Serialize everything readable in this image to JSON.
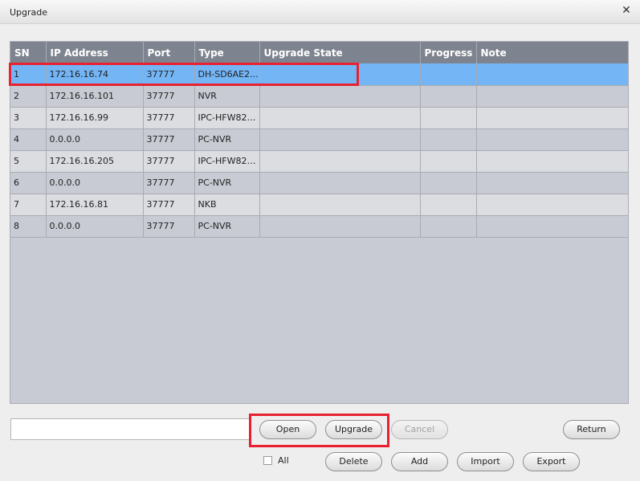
{
  "window": {
    "title": "Upgrade",
    "close_glyph": "✕"
  },
  "table": {
    "columns": [
      "SN",
      "IP Address",
      "Port",
      "Type",
      "Upgrade State",
      "Progress",
      "Note"
    ],
    "rows": [
      {
        "sn": "1",
        "ip": "172.16.16.74",
        "port": "37777",
        "type": "DH-SD6AE2...",
        "state": "",
        "progress": "",
        "note": ""
      },
      {
        "sn": "2",
        "ip": "172.16.16.101",
        "port": "37777",
        "type": "NVR",
        "state": "",
        "progress": "",
        "note": ""
      },
      {
        "sn": "3",
        "ip": "172.16.16.99",
        "port": "37777",
        "type": "IPC-HFW828...",
        "state": "",
        "progress": "",
        "note": ""
      },
      {
        "sn": "4",
        "ip": "0.0.0.0",
        "port": "37777",
        "type": "PC-NVR",
        "state": "",
        "progress": "",
        "note": ""
      },
      {
        "sn": "5",
        "ip": "172.16.16.205",
        "port": "37777",
        "type": "IPC-HFW828...",
        "state": "",
        "progress": "",
        "note": ""
      },
      {
        "sn": "6",
        "ip": "0.0.0.0",
        "port": "37777",
        "type": "PC-NVR",
        "state": "",
        "progress": "",
        "note": ""
      },
      {
        "sn": "7",
        "ip": "172.16.16.81",
        "port": "37777",
        "type": "NKB",
        "state": "",
        "progress": "",
        "note": ""
      },
      {
        "sn": "8",
        "ip": "0.0.0.0",
        "port": "37777",
        "type": "PC-NVR",
        "state": "",
        "progress": "",
        "note": ""
      }
    ],
    "selected_row": 0
  },
  "file": {
    "value": ""
  },
  "buttons": {
    "open": "Open",
    "upgrade": "Upgrade",
    "cancel": "Cancel",
    "return": "Return",
    "delete": "Delete",
    "add": "Add",
    "import": "Import",
    "export": "Export"
  },
  "all_checkbox": {
    "label": "All",
    "checked": false
  },
  "colors": {
    "header_bg": "#7e848f",
    "selected_row_bg": "#73b5f5",
    "highlight_border": "#e8202f"
  }
}
